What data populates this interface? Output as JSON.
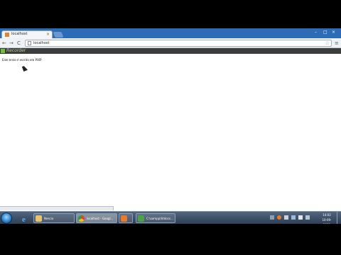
{
  "browser": {
    "tab": {
      "title": "localhost",
      "close": "×"
    },
    "controls": {
      "minimize": "–",
      "maximize": "□",
      "close": "×"
    },
    "nav": {
      "back": "←",
      "forward": "→",
      "reload": "C"
    },
    "address": {
      "url": "localhost"
    },
    "star": "☆",
    "menu": "≡",
    "extension_label": "Recorder"
  },
  "page": {
    "text": "Este texto é escrito em PHP"
  },
  "taskbar": {
    "tasks": [
      {
        "label": "Nescio",
        "icon_color": "#e8c46a"
      },
      {
        "label": "localhost - Googl...",
        "icon_color": "#d9452f"
      },
      {
        "label": "",
        "icon_color": "#e87a2c"
      },
      {
        "label": "C:\\xampp\\htdocs...",
        "icon_color": "#4aa24a"
      }
    ],
    "clock": {
      "time": "14:02",
      "date": "10-09-2013"
    }
  }
}
